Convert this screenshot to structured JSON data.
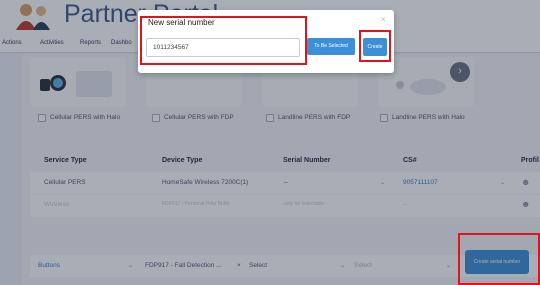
{
  "app": {
    "brand_title": "Partner Portal"
  },
  "nav": {
    "items": [
      "Actions",
      "Activities",
      "Reports",
      "Dashbo"
    ]
  },
  "products": [
    {
      "label": "Cellular PERS with Halo"
    },
    {
      "label": "Cellular PERS with FDP"
    },
    {
      "label": "Landline PERS with FDP"
    },
    {
      "label": "Landline PERS with Halo"
    }
  ],
  "table": {
    "headers": [
      "Service Type",
      "Device Type",
      "Serial Number",
      "CS#",
      "Profil"
    ],
    "row1": {
      "service": "Cellular PERS",
      "device": "HomeSafe Wireless 7200C(1)",
      "serial": "–",
      "cs": "9057111107"
    },
    "row2": {
      "service": "Wireless",
      "device": "FDP917 - Personal Help Butto",
      "serial": "only be selectable",
      "cs": "–"
    }
  },
  "bottom_row": {
    "service": "Buttons",
    "device": "FDP917 - Fall Detection ...",
    "serial": "Select",
    "cs": "Select"
  },
  "create_serial_button": "Create serial number",
  "modal": {
    "title": "New serial number",
    "close": "×",
    "serial_value": "1011234567",
    "to_be_selected_label": "To Be Selected",
    "create_label": "Create"
  },
  "colors": {
    "accent": "#3d8fd7",
    "highlight": "#e0141b",
    "brand": "#3d5a86"
  }
}
